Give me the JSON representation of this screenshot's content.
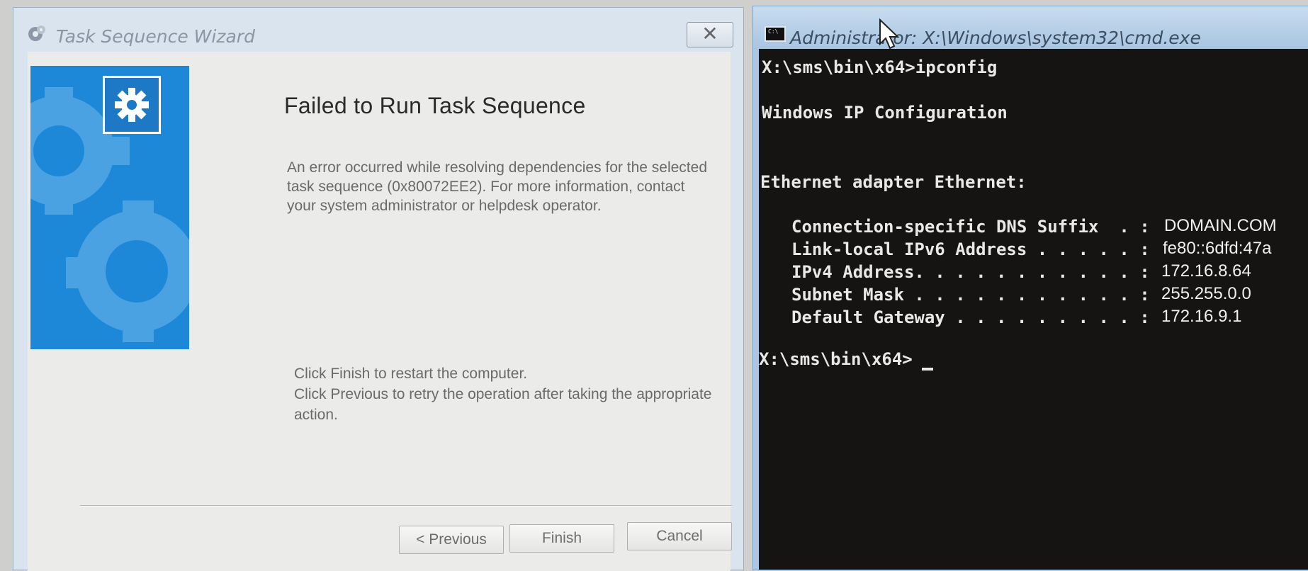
{
  "wizard": {
    "title": "Task Sequence Wizard",
    "close_glyph": "✕",
    "heading": "Failed to Run Task Sequence",
    "error_lines": [
      "An error occurred while resolving dependencies for the selected",
      "task sequence (0x80072EE2). For more information, contact",
      "your system administrator or helpdesk operator."
    ],
    "instruction_lines": [
      "Click Finish to restart the computer.",
      "Click Previous to retry the operation after taking the appropriate",
      "action."
    ],
    "buttons": {
      "previous": "< Previous",
      "finish": "Finish",
      "cancel": "Cancel"
    },
    "banner_color": "#1e88d8"
  },
  "cmd": {
    "title": "Administrator: X:\\Windows\\system32\\cmd.exe",
    "icon_text": "C:\\",
    "lines": {
      "prompt1": "X:\\sms\\bin\\x64>ipconfig",
      "header": "Windows IP Configuration",
      "adapter": "Ethernet adapter Ethernet:",
      "dns_label": "Connection-specific DNS Suffix  . :",
      "dns_value": "DOMAIN.COM",
      "ipv6_label": "Link-local IPv6 Address . . . . . :",
      "ipv6_value": "fe80::6dfd:47a",
      "ipv4_label": "IPv4 Address. . . . . . . . . . . :",
      "ipv4_value": "172.16.8.64",
      "mask_label": "Subnet Mask . . . . . . . . . . . :",
      "mask_value": "255.255.0.0",
      "gw_label": "Default Gateway . . . . . . . . . :",
      "gw_value": "172.16.9.1",
      "prompt2": "X:\\sms\\bin\\x64>"
    }
  }
}
